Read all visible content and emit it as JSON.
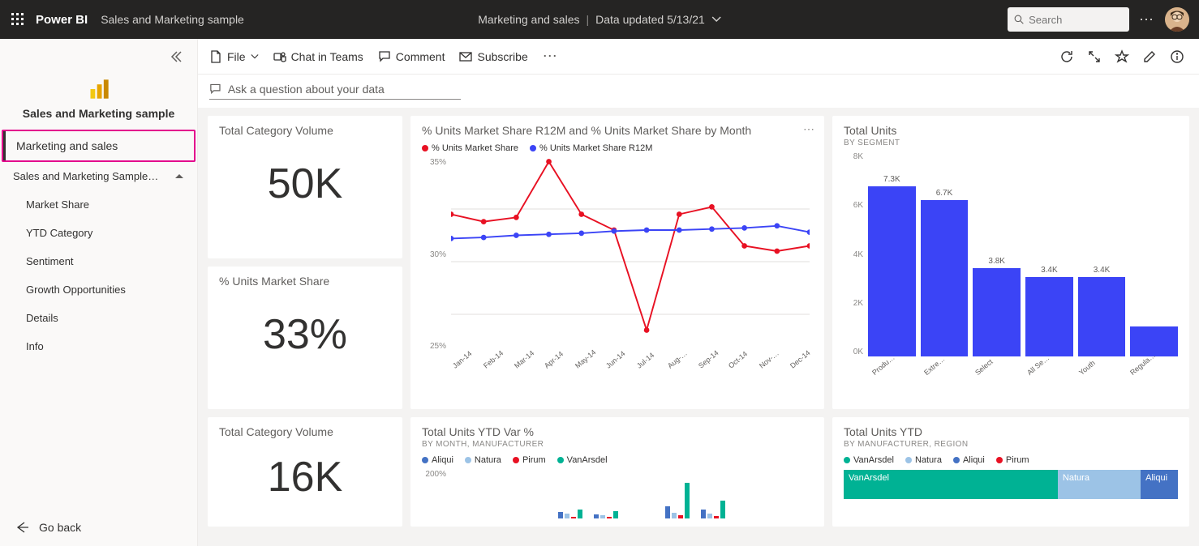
{
  "header": {
    "brand": "Power BI",
    "workspace": "Sales and Marketing sample",
    "breadcrumb_page": "Marketing and sales",
    "data_updated": "Data updated 5/13/21",
    "search_placeholder": "Search"
  },
  "toolbar": {
    "file": "File",
    "chat": "Chat in Teams",
    "comment": "Comment",
    "subscribe": "Subscribe"
  },
  "qna": {
    "placeholder": "Ask a question about your data"
  },
  "sidebar": {
    "dataset_title": "Sales and Marketing sample",
    "active_item": "Marketing and sales",
    "group_label": "Sales and Marketing Sample…",
    "items": [
      "Market Share",
      "YTD Category",
      "Sentiment",
      "Growth Opportunities",
      "Details",
      "Info"
    ],
    "go_back": "Go back"
  },
  "tiles": {
    "tcv1": {
      "title": "Total Category Volume",
      "value": "50K"
    },
    "ums": {
      "title": "% Units Market Share",
      "value": "33%"
    },
    "tcv2": {
      "title": "Total Category Volume",
      "value": "16K"
    },
    "line": {
      "title": "% Units Market Share R12M and % Units Market Share by Month",
      "legend": [
        "% Units Market Share",
        "% Units Market Share R12M"
      ]
    },
    "bars": {
      "title": "Total Units",
      "subtitle": "By Segment"
    },
    "ytdvar": {
      "title": "Total Units YTD Var %",
      "subtitle": "By Month, Manufacturer",
      "legend": [
        "Aliqui",
        "Natura",
        "Pirum",
        "VanArsdel"
      ]
    },
    "ytd": {
      "title": "Total Units YTD",
      "subtitle": "By Manufacturer, Region",
      "legend": [
        "VanArsdel",
        "Natura",
        "Aliqui",
        "Pirum"
      ]
    }
  },
  "colors": {
    "red": "#e81123",
    "blue": "#3b44f6",
    "teal": "#00b294",
    "ltblue": "#9cc3e6",
    "midblue": "#4472c4"
  },
  "chart_data": [
    {
      "id": "line",
      "type": "line",
      "title": "% Units Market Share R12M and % Units Market Share by Month",
      "x": [
        "Jan-14",
        "Feb-14",
        "Mar-14",
        "Apr-14",
        "May-14",
        "Jun-14",
        "Jul-14",
        "Aug-…",
        "Sep-14",
        "Oct-14",
        "Nov-…",
        "Dec-14"
      ],
      "ylabel": "%",
      "yticks": [
        "35%",
        "30%",
        "25%"
      ],
      "ylim": [
        23,
        40
      ],
      "series": [
        {
          "name": "% Units Market Share",
          "color": "#e81123",
          "values": [
            34.5,
            33.8,
            34.2,
            39.5,
            34.5,
            33.0,
            23.5,
            34.5,
            35.2,
            31.5,
            31.0,
            31.5
          ]
        },
        {
          "name": "% Units Market Share R12M",
          "color": "#3b44f6",
          "values": [
            32.2,
            32.3,
            32.5,
            32.6,
            32.7,
            32.9,
            33.0,
            33.0,
            33.1,
            33.2,
            33.4,
            32.8
          ]
        }
      ]
    },
    {
      "id": "bars",
      "type": "bar",
      "title": "Total Units by Segment",
      "categories": [
        "Produ…",
        "Extre…",
        "Select",
        "All Se…",
        "Youth",
        "Regula…"
      ],
      "value_labels": [
        "7.3K",
        "6.7K",
        "3.8K",
        "3.4K",
        "3.4K",
        ""
      ],
      "values": [
        7300,
        6700,
        3800,
        3400,
        3400,
        1300
      ],
      "ylim": [
        0,
        8000
      ],
      "yticks": [
        "8K",
        "6K",
        "4K",
        "2K",
        "0K"
      ],
      "color": "#3b44f6"
    },
    {
      "id": "ytdvar",
      "type": "bar",
      "title": "Total Units YTD Var % by Month, Manufacturer",
      "yticks": [
        "200%"
      ],
      "series_colors": {
        "Aliqui": "#4472c4",
        "Natura": "#9cc3e6",
        "Pirum": "#e81123",
        "VanArsdel": "#00b294"
      },
      "months": 8,
      "sample_values": [
        [
          0,
          0,
          0,
          0
        ],
        [
          0,
          0,
          0,
          0
        ],
        [
          0,
          0,
          0,
          0
        ],
        [
          40,
          30,
          10,
          55
        ],
        [
          25,
          18,
          8,
          45
        ],
        [
          0,
          0,
          0,
          0
        ],
        [
          70,
          35,
          20,
          210
        ],
        [
          55,
          30,
          15,
          105
        ]
      ]
    },
    {
      "id": "ytd_treemap",
      "type": "area",
      "title": "Total Units YTD by Manufacturer, Region",
      "cells": [
        {
          "name": "VanArsdel",
          "share": 0.67,
          "color": "#00b294"
        },
        {
          "name": "Natura",
          "share": 0.24,
          "color": "#9cc3e6"
        },
        {
          "name": "Aliqui",
          "share": 0.09,
          "color": "#4472c4"
        }
      ]
    }
  ]
}
